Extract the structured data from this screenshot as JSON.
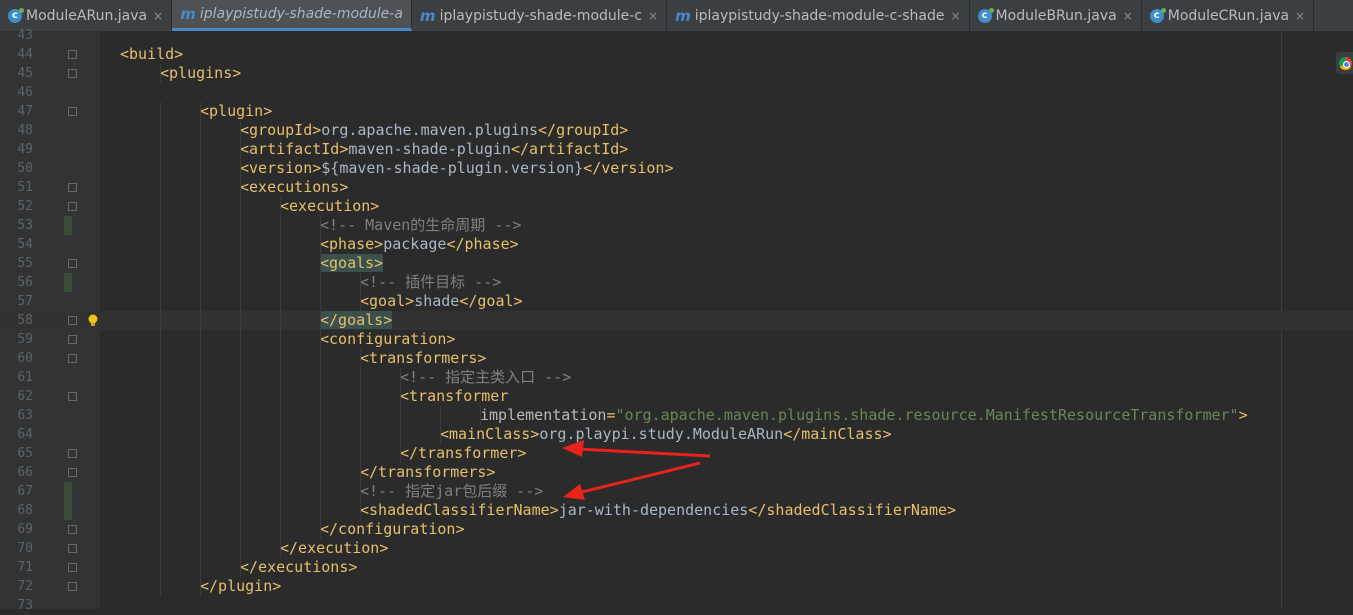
{
  "tabs": [
    {
      "label": "ModuleARun.java",
      "icon": "java-class-icon",
      "active": false,
      "close": "×"
    },
    {
      "label": "iplaypistudy-shade-module-a",
      "icon": "maven-icon",
      "active": true,
      "close": ""
    },
    {
      "label": "iplaypistudy-shade-module-c",
      "icon": "maven-icon",
      "active": false,
      "close": "×"
    },
    {
      "label": "iplaypistudy-shade-module-c-shade",
      "icon": "maven-icon",
      "active": false,
      "close": "×"
    },
    {
      "label": "ModuleBRun.java",
      "icon": "java-class-icon",
      "active": false,
      "close": "×"
    },
    {
      "label": "ModuleCRun.java",
      "icon": "java-class-icon",
      "active": false,
      "close": "×"
    }
  ],
  "lines": [
    {
      "n": "43",
      "indent": 0,
      "parts": []
    },
    {
      "n": "44",
      "indent": 0,
      "parts": [
        [
          "tag",
          "<build>"
        ]
      ]
    },
    {
      "n": "45",
      "indent": 1,
      "parts": [
        [
          "tag",
          "<plugins>"
        ]
      ]
    },
    {
      "n": "46",
      "indent": 0,
      "parts": []
    },
    {
      "n": "47",
      "indent": 2,
      "parts": [
        [
          "tag",
          "<plugin>"
        ]
      ]
    },
    {
      "n": "48",
      "indent": 3,
      "parts": [
        [
          "tag",
          "<groupId>"
        ],
        [
          "txt",
          "org.apache.maven.plugins"
        ],
        [
          "tag",
          "</groupId>"
        ]
      ]
    },
    {
      "n": "49",
      "indent": 3,
      "parts": [
        [
          "tag",
          "<artifactId>"
        ],
        [
          "txt",
          "maven-shade-plugin"
        ],
        [
          "tag",
          "</artifactId>"
        ]
      ]
    },
    {
      "n": "50",
      "indent": 3,
      "parts": [
        [
          "tag",
          "<version>"
        ],
        [
          "txt",
          "${maven-shade-plugin.version}"
        ],
        [
          "tag",
          "</version>"
        ]
      ]
    },
    {
      "n": "51",
      "indent": 3,
      "parts": [
        [
          "tag",
          "<executions>"
        ]
      ]
    },
    {
      "n": "52",
      "indent": 4,
      "parts": [
        [
          "tag",
          "<execution>"
        ]
      ]
    },
    {
      "n": "53",
      "indent": 5,
      "parts": [
        [
          "cmt",
          "<!-- Maven的生命周期 -->"
        ]
      ]
    },
    {
      "n": "54",
      "indent": 5,
      "parts": [
        [
          "tag",
          "<phase>"
        ],
        [
          "txt",
          "package"
        ],
        [
          "tag",
          "</phase>"
        ]
      ]
    },
    {
      "n": "55",
      "indent": 5,
      "parts": [
        [
          "taghl",
          "<goals>"
        ]
      ]
    },
    {
      "n": "56",
      "indent": 6,
      "parts": [
        [
          "cmt",
          "<!-- 插件目标 -->"
        ]
      ]
    },
    {
      "n": "57",
      "indent": 6,
      "parts": [
        [
          "tag",
          "<goal>"
        ],
        [
          "txt",
          "shade"
        ],
        [
          "tag",
          "</goal>"
        ]
      ]
    },
    {
      "n": "58",
      "indent": 5,
      "parts": [
        [
          "taghl",
          "</goals>"
        ]
      ]
    },
    {
      "n": "59",
      "indent": 5,
      "parts": [
        [
          "tag",
          "<configuration>"
        ]
      ]
    },
    {
      "n": "60",
      "indent": 6,
      "parts": [
        [
          "tag",
          "<transformers>"
        ]
      ]
    },
    {
      "n": "61",
      "indent": 7,
      "parts": [
        [
          "cmt",
          "<!-- 指定主类入口 -->"
        ]
      ]
    },
    {
      "n": "62",
      "indent": 7,
      "parts": [
        [
          "tag",
          "<transformer"
        ]
      ]
    },
    {
      "n": "63",
      "indent": 9,
      "parts": [
        [
          "attr",
          "implementation"
        ],
        [
          "tag",
          "="
        ],
        [
          "str",
          "\"org.apache.maven.plugins.shade.resource.ManifestResourceTransformer\""
        ],
        [
          "tag",
          ">"
        ]
      ]
    },
    {
      "n": "64",
      "indent": 8,
      "parts": [
        [
          "tag",
          "<mainClass>"
        ],
        [
          "txt",
          "org.playpi.study.ModuleARun"
        ],
        [
          "tag",
          "</mainClass>"
        ]
      ]
    },
    {
      "n": "65",
      "indent": 7,
      "parts": [
        [
          "tag",
          "</transformer>"
        ]
      ]
    },
    {
      "n": "66",
      "indent": 6,
      "parts": [
        [
          "tag",
          "</transformers>"
        ]
      ]
    },
    {
      "n": "67",
      "indent": 6,
      "parts": [
        [
          "cmt",
          "<!-- 指定jar包后缀 -->"
        ]
      ]
    },
    {
      "n": "68",
      "indent": 6,
      "parts": [
        [
          "tag",
          "<shadedClassifierName>"
        ],
        [
          "txt",
          "jar-with-dependencies"
        ],
        [
          "tag",
          "</shadedClassifierName>"
        ]
      ]
    },
    {
      "n": "69",
      "indent": 5,
      "parts": [
        [
          "tag",
          "</configuration>"
        ]
      ]
    },
    {
      "n": "70",
      "indent": 4,
      "parts": [
        [
          "tag",
          "</execution>"
        ]
      ]
    },
    {
      "n": "71",
      "indent": 3,
      "parts": [
        [
          "tag",
          "</executions>"
        ]
      ]
    },
    {
      "n": "72",
      "indent": 2,
      "parts": [
        [
          "tag",
          "</plugin>"
        ]
      ]
    },
    {
      "n": "73",
      "indent": 0,
      "parts": []
    }
  ],
  "colors": {
    "tag": "#e8bf6a",
    "text": "#a9b7c6",
    "comment": "#808080",
    "string": "#6a8759",
    "annotation_arrow": "#e8231b",
    "active_tab_underline": "#4a88c7"
  }
}
